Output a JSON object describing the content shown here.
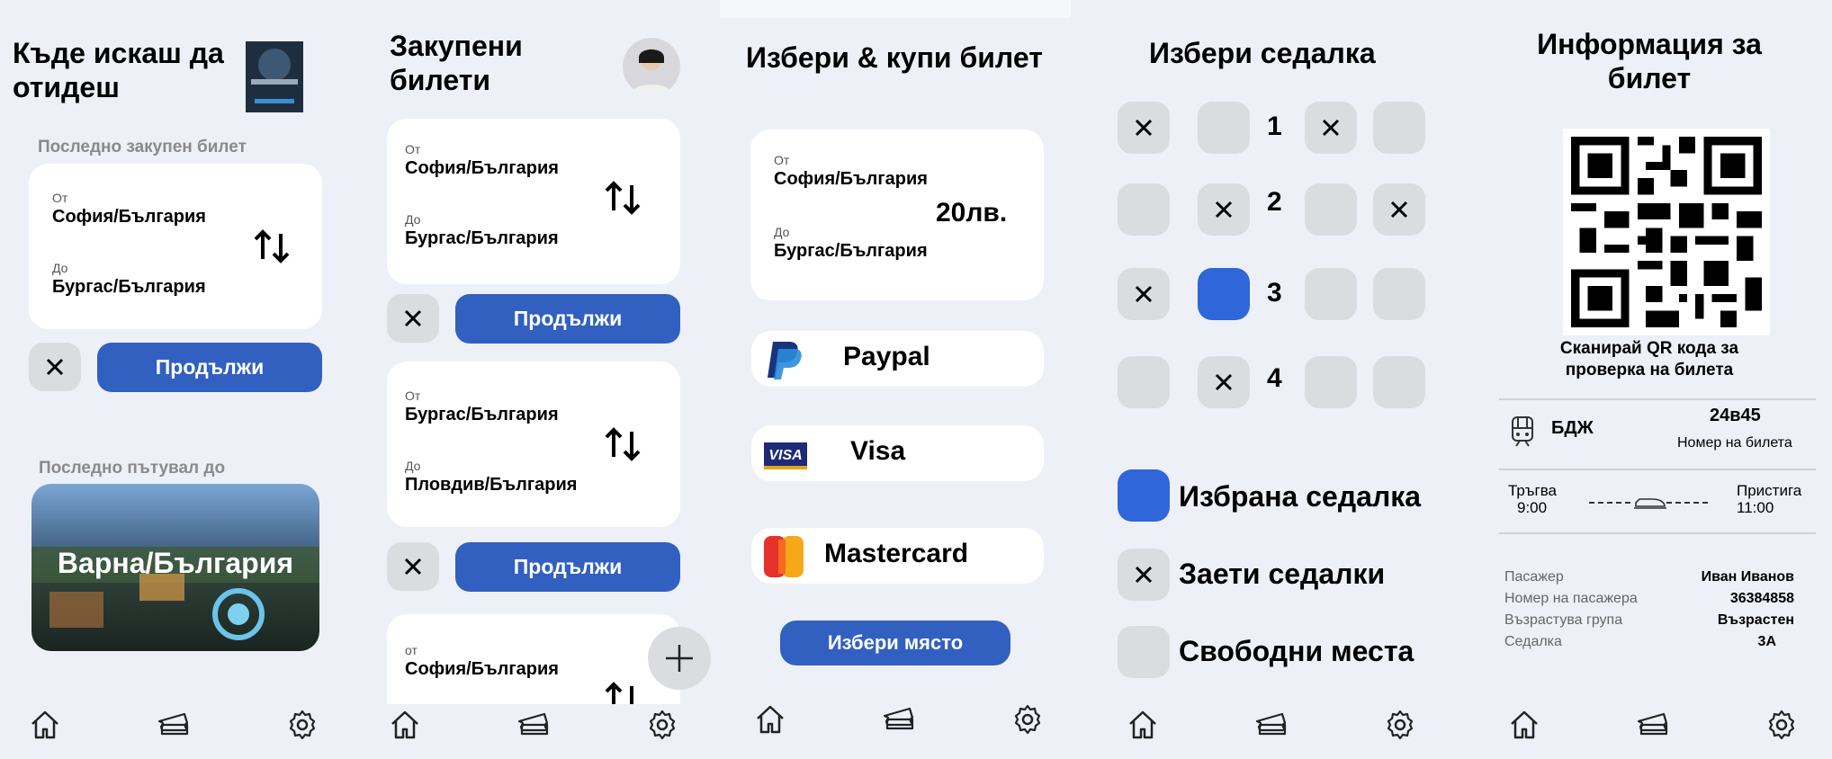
{
  "colors": {
    "accent": "#3160c0",
    "background": "#eef0f8",
    "seat_selected": "#2f66d9",
    "seat_default": "#dadcdf"
  },
  "screen1": {
    "title_line1": "Къде искаш да",
    "title_line2": "отидеш",
    "last_bought_label": "Последно закупен билет",
    "from_label": "От",
    "from_city": "София/България",
    "to_label": "До",
    "to_city": "Бургас/България",
    "continue_label": "Продължи",
    "last_travel_label": "Последно пътувал до",
    "destination": "Варна/България"
  },
  "screen2": {
    "title_line1": "Закупени",
    "title_line2": "билети",
    "tickets": [
      {
        "from_label": "От",
        "from": "София/България",
        "to_label": "До",
        "to": "Бургас/България"
      },
      {
        "from_label": "От",
        "from": "Бургас/България",
        "to_label": "До",
        "to": "Пловдив/България"
      },
      {
        "from_label": "от",
        "from": "София/България"
      }
    ],
    "continue_label": "Продължи"
  },
  "screen3": {
    "title": "Избери & купи билет",
    "from_label": "От",
    "from": "София/България",
    "to_label": "До",
    "to": "Бургас/България",
    "price": "20лв.",
    "payments": [
      {
        "name": "Paypal",
        "icon": "paypal-icon"
      },
      {
        "name": "Visa",
        "icon": "visa-icon",
        "badge": "VISA"
      },
      {
        "name": "Mastercard",
        "icon": "mastercard-icon"
      }
    ],
    "choose_seat_label": "Избери място"
  },
  "screen4": {
    "title": "Избери седалка",
    "rows": [
      "1",
      "2",
      "3",
      "4"
    ],
    "legend": {
      "selected": "Избрана седалка",
      "taken": "Заети седалки",
      "free": "Свободни места"
    }
  },
  "screen5": {
    "title_line1": "Информация за",
    "title_line2": "билет",
    "qr_caption_line1": "Сканирай QR кода за",
    "qr_caption_line2": "проверка на билета",
    "operator": "БДЖ",
    "ticket_no": "24в45",
    "ticket_no_label": "Номер на билета",
    "departure_label": "Тръгва",
    "departure_time": "9:00",
    "arrival_label": "Пристига",
    "arrival_time": "11:00",
    "details": [
      {
        "k": "Пасажер",
        "v": "Иван Иванов"
      },
      {
        "k": "Номер на пасажера",
        "v": "36384858"
      },
      {
        "k": "Възрастува група",
        "v": "Възрастен"
      },
      {
        "k": "Седалка",
        "v": "3А"
      }
    ]
  }
}
